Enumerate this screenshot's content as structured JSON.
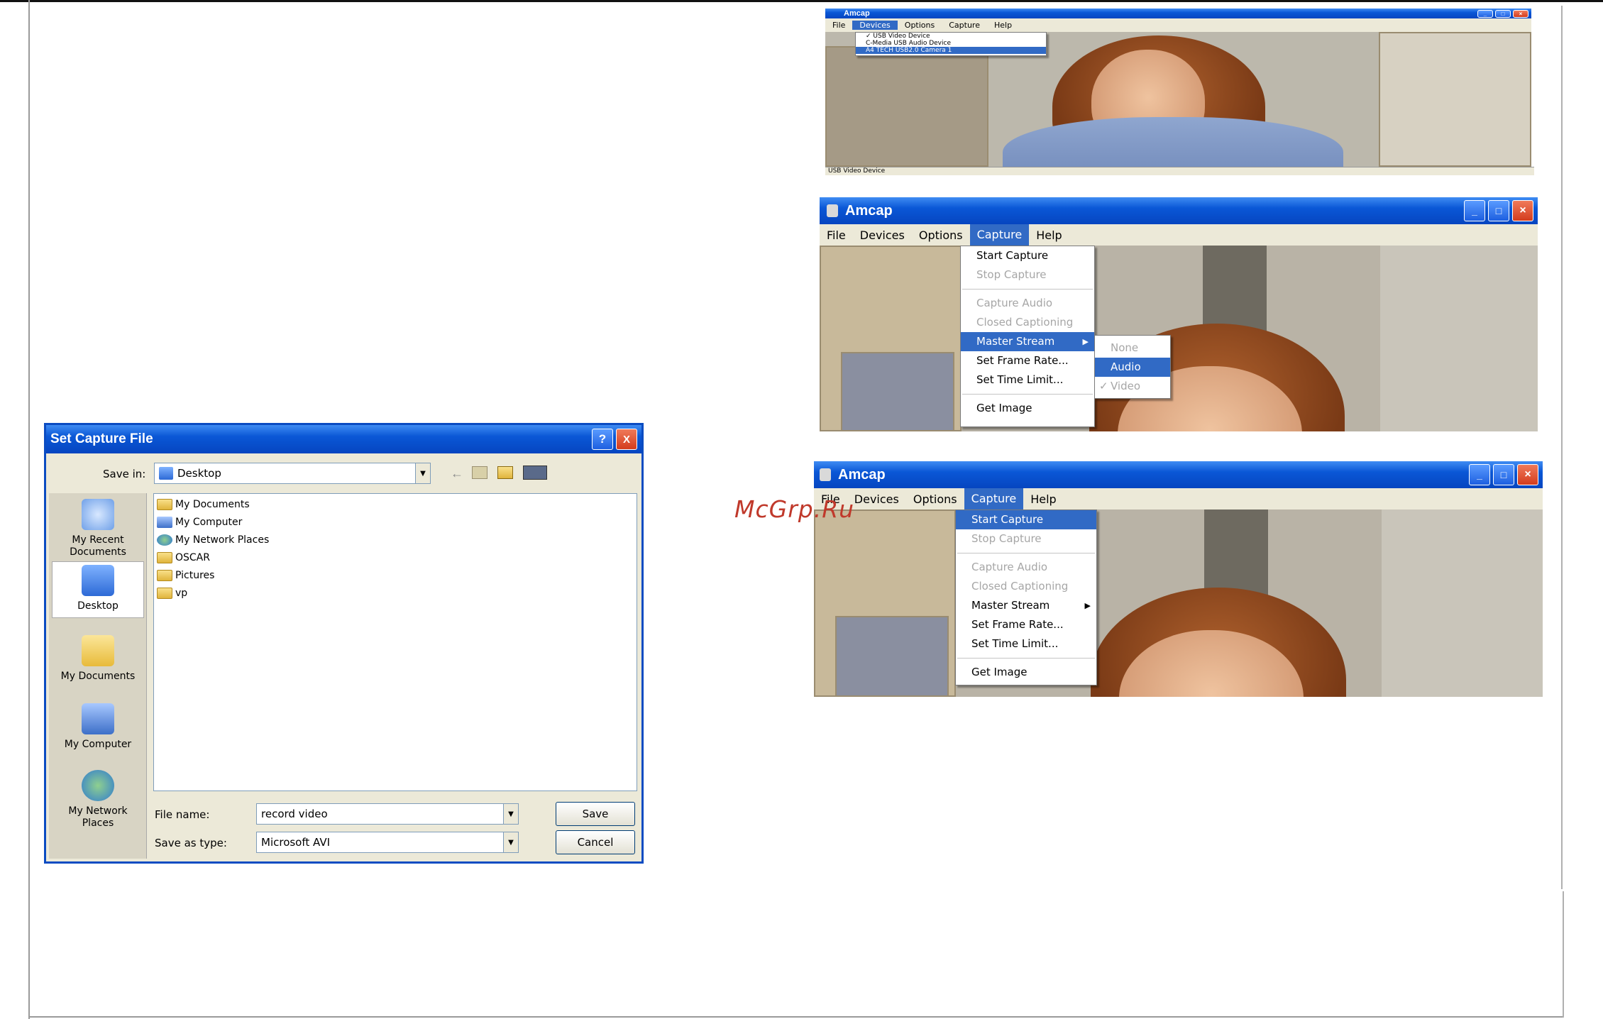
{
  "watermark": "McGrp.Ru",
  "colors": {
    "xp_title_blue": "#0a57d6",
    "menu_highlight": "#316ac5",
    "dialog_bg": "#ece9d8"
  },
  "window_top": {
    "title": "Amcap",
    "menu": [
      "File",
      "Devices",
      "Options",
      "Capture",
      "Help"
    ],
    "selected_menu": "Devices",
    "devices_menu": [
      {
        "label": "USB Video Device",
        "checked": true
      },
      {
        "label": "C-Media USB Audio Device",
        "checked": false
      },
      {
        "label": "A4 TECH USB2.0 Camera 1",
        "highlight": true
      }
    ],
    "status": "USB Video Device"
  },
  "window_mid": {
    "title": "Amcap",
    "menu": [
      "File",
      "Devices",
      "Options",
      "Capture",
      "Help"
    ],
    "selected_menu": "Capture",
    "capture_menu": [
      {
        "label": "Start Capture",
        "disabled": false
      },
      {
        "label": "Stop Capture",
        "disabled": true
      },
      {
        "label": "Capture Audio",
        "disabled": true
      },
      {
        "label": "Closed Captioning",
        "disabled": true
      },
      {
        "label": "Master Stream",
        "highlight": true,
        "submenu": true
      },
      {
        "label": "Set Frame Rate...",
        "disabled": false
      },
      {
        "label": "Set Time Limit...",
        "disabled": false
      },
      {
        "label": "Get Image",
        "disabled": false
      }
    ],
    "submenu": [
      {
        "label": "None",
        "disabled": true
      },
      {
        "label": "Audio",
        "highlight": true
      },
      {
        "label": "Video",
        "checked": true,
        "disabled": true
      }
    ]
  },
  "window_bot": {
    "title": "Amcap",
    "menu": [
      "File",
      "Devices",
      "Options",
      "Capture",
      "Help"
    ],
    "selected_menu": "Capture",
    "capture_menu": [
      {
        "label": "Start Capture",
        "highlight": true
      },
      {
        "label": "Stop Capture",
        "disabled": true
      },
      {
        "label": "Capture Audio",
        "disabled": true
      },
      {
        "label": "Closed Captioning",
        "disabled": true
      },
      {
        "label": "Master Stream",
        "submenu": true
      },
      {
        "label": "Set Frame Rate...",
        "disabled": false
      },
      {
        "label": "Set Time Limit...",
        "disabled": false
      },
      {
        "label": "Get Image",
        "disabled": false
      }
    ]
  },
  "save_dialog": {
    "title": "Set Capture File",
    "save_in_label": "Save in:",
    "save_in_value": "Desktop",
    "places": [
      "My Recent Documents",
      "Desktop",
      "My Documents",
      "My Computer",
      "My Network Places"
    ],
    "files": [
      "My Documents",
      "My Computer",
      "My Network Places",
      "OSCAR",
      "Pictures",
      "vp"
    ],
    "file_name_label": "File name:",
    "file_name_value": "record video",
    "save_as_type_label": "Save as type:",
    "save_as_type_value": "Microsoft AVI",
    "save_button": "Save",
    "cancel_button": "Cancel",
    "help_glyph": "?",
    "close_glyph": "X"
  }
}
